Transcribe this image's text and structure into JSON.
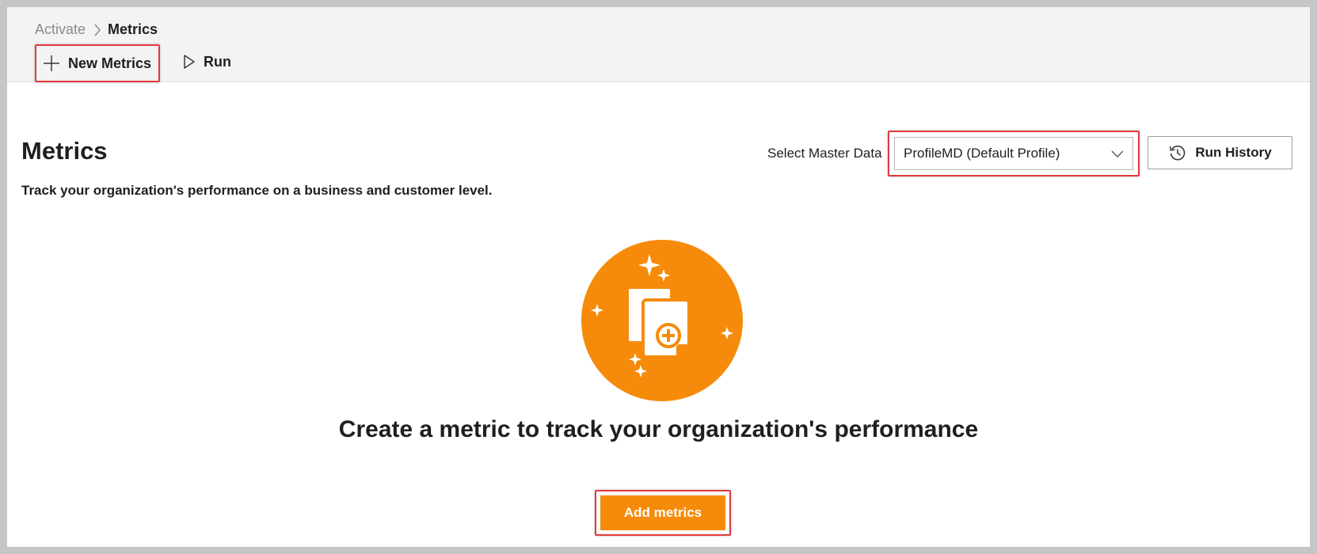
{
  "breadcrumb": {
    "parent": "Activate",
    "current": "Metrics"
  },
  "toolbar": {
    "new_metrics_label": "New Metrics",
    "run_label": "Run"
  },
  "header": {
    "title": "Metrics",
    "description": "Track your organization's performance on a business and customer level.",
    "master_data_label": "Select Master Data",
    "master_data_value": "ProfileMD (Default Profile)",
    "run_history_label": "Run History"
  },
  "empty_state": {
    "heading": "Create a metric to track your organization's performance",
    "button_label": "Add metrics"
  },
  "colors": {
    "accent": "#f68b0b",
    "highlight": "#e03a3e",
    "command_bar": "#f3f3f3",
    "text": "#1f1f1f"
  },
  "icons": {
    "new": "plus-icon",
    "run": "play-icon",
    "dropdown": "chevron-down-icon",
    "history": "history-icon",
    "hero": "new-document-sparkle-icon"
  }
}
